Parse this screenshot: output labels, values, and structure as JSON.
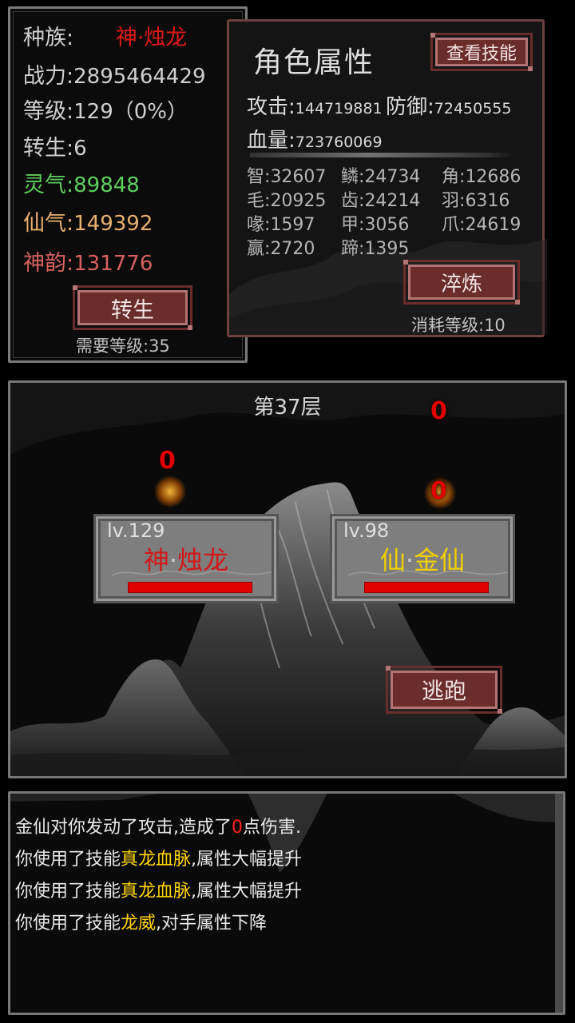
{
  "stats": {
    "race_label": "种族:",
    "race_value": "神·烛龙",
    "power_label": "战力:",
    "power_value": "2895464429",
    "level_label": "等级:",
    "level_value": "129（0%）",
    "rebirth_label": "转生:",
    "rebirth_value": "6",
    "lingqi_label": "灵气:",
    "lingqi_value": "89848",
    "xianqi_label": "仙气:",
    "xianqi_value": "149392",
    "shenyun_label": "神韵:",
    "shenyun_value": "131776",
    "rebirth_button": "转生",
    "rebirth_requirement": "需要等级:35"
  },
  "attributes": {
    "title": "角色属性",
    "view_skills_button": "查看技能",
    "attack_label": "攻击:",
    "attack_value": "144719881",
    "defense_label": "防御:",
    "defense_value": "72450555",
    "hp_label": "血量:",
    "hp_value": "723760069",
    "grid": [
      {
        "label": "智",
        "value": "32607"
      },
      {
        "label": "鳞",
        "value": "24734"
      },
      {
        "label": "角",
        "value": "12686"
      },
      {
        "label": "毛",
        "value": "20925"
      },
      {
        "label": "齿",
        "value": "24214"
      },
      {
        "label": "羽",
        "value": "6316"
      },
      {
        "label": "喙",
        "value": "1597"
      },
      {
        "label": "甲",
        "value": "3056"
      },
      {
        "label": "爪",
        "value": "24619"
      },
      {
        "label": "赢",
        "value": "2720"
      },
      {
        "label": "蹄",
        "value": "1395"
      }
    ],
    "refine_button": "淬炼",
    "refine_cost": "消耗等级:10"
  },
  "battle": {
    "floor": "第37层",
    "player": {
      "level": "lv.129",
      "prefix": "神",
      "name": "烛龙",
      "hp_fraction": 1.0
    },
    "enemy": {
      "level": "lv.98",
      "prefix": "仙",
      "name": "金仙",
      "hp_fraction": 1.0
    },
    "damage_player": "0",
    "damage_enemy_top": "0",
    "damage_enemy_hit": "0",
    "flee_button": "逃跑"
  },
  "log": {
    "lines": [
      {
        "a": "金仙对你发动了攻击,造成了",
        "b": "0",
        "c": "点伤害."
      },
      {
        "a": "你使用了技能",
        "b": "真龙血脉",
        "c": ",属性大幅提升"
      },
      {
        "a": "你使用了技能",
        "b": "真龙血脉",
        "c": ",属性大幅提升"
      },
      {
        "a": "你使用了技能",
        "b": "龙威",
        "c": ",对手属性下降"
      }
    ]
  },
  "colors": {
    "race": "#e01818",
    "lingqi": "#5fcf5f",
    "xianqi": "#e8b070",
    "shenyun": "#d86060",
    "player_name": "#d01818",
    "enemy_name": "#f0d000",
    "button_bg": "#6b2c2c"
  }
}
